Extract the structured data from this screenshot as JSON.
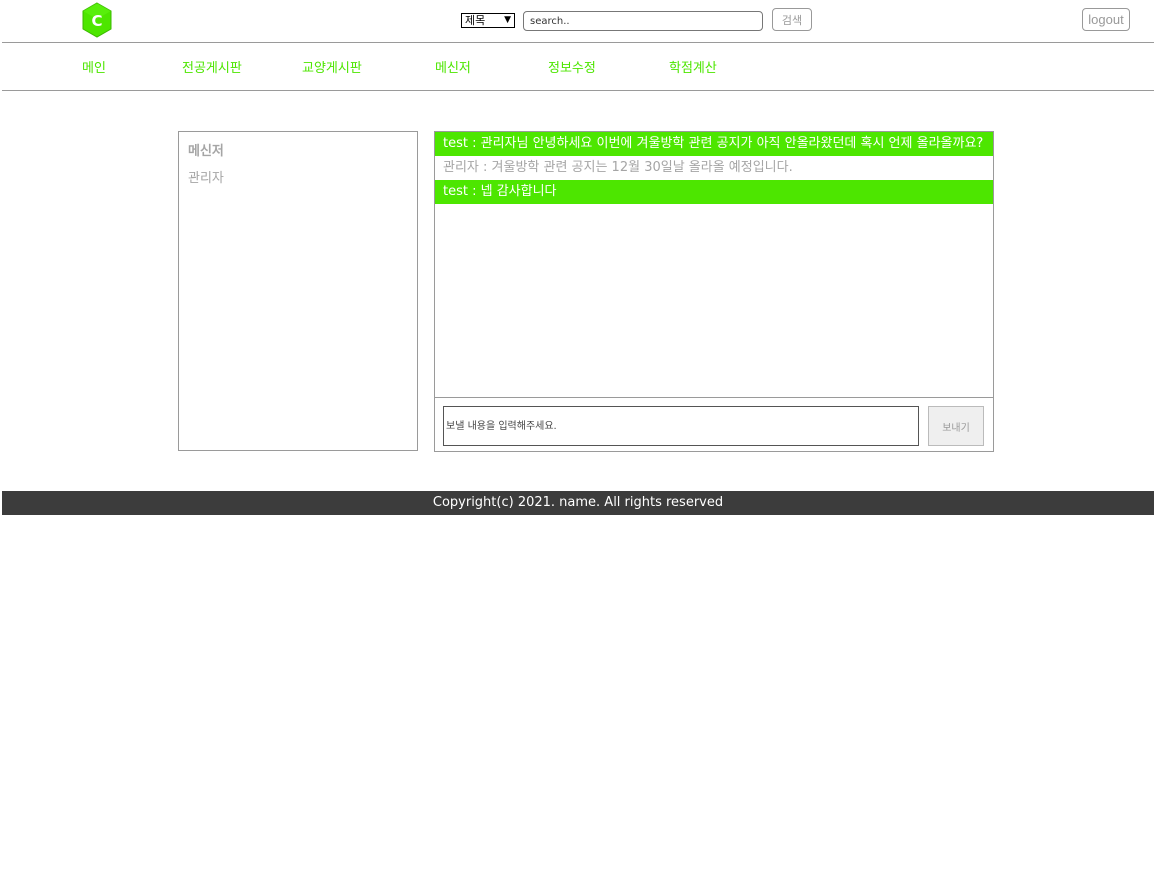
{
  "header": {
    "logo_letter": "C",
    "search_field_selected": "제목",
    "search_placeholder": "search..",
    "search_button": "검색",
    "logout_button": "logout"
  },
  "nav": {
    "items": [
      {
        "label": "메인"
      },
      {
        "label": "전공게시판"
      },
      {
        "label": "교양게시판"
      },
      {
        "label": "메신저"
      },
      {
        "label": "정보수정"
      },
      {
        "label": "학점계산"
      }
    ]
  },
  "sidebar": {
    "title": "메신저",
    "contacts": [
      {
        "name": "관리자"
      }
    ]
  },
  "chat": {
    "messages": [
      {
        "sender": "test",
        "text": "test : 관리자님 안녕하세요 이번에 겨울방학 관련 공지가 아직 안올라왔던데 혹시 언제 올라올까요?"
      },
      {
        "sender": "관리자",
        "text": "관리자 : 겨울방학 관련 공지는 12월 30일날 올라올 예정입니다."
      },
      {
        "sender": "test",
        "text": "test : 넵 감사합니다"
      }
    ],
    "input_placeholder": "보낼 내용을 입력해주세요.",
    "send_button": "보내기"
  },
  "footer": {
    "copyright": "Copyright(c) 2021. name. All rights reserved"
  },
  "colors": {
    "accent": "#4de600",
    "muted_text": "#a5a5a5",
    "footer_bg": "#3c3c3c",
    "border": "#9a9a9a"
  },
  "icons": {
    "logo": "hexagon-c-logo-icon",
    "select_arrow": "chevron-down-icon"
  }
}
